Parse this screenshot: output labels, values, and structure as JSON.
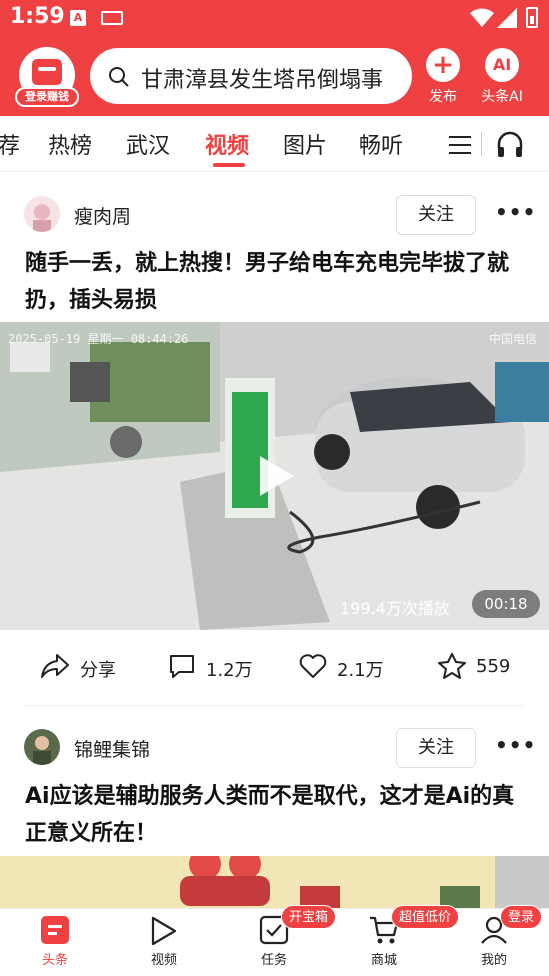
{
  "status_bar": {
    "time": "1:59"
  },
  "header": {
    "login_badge": "登录赚钱",
    "search_text": "甘肃漳县发生塔吊倒塌事",
    "publish_label": "发布",
    "ai_label": "头条AI",
    "ai_icon_text": "AI"
  },
  "tabs": [
    {
      "label": "荐"
    },
    {
      "label": "热榜"
    },
    {
      "label": "武汉"
    },
    {
      "label": "视频"
    },
    {
      "label": "图片"
    },
    {
      "label": "畅听"
    }
  ],
  "active_tab": "视频",
  "posts": [
    {
      "author": "瘦肉周",
      "follow_label": "关注",
      "title": "随手一丢，就上热搜！男子给电车充电完毕拔了就扔，插头易损",
      "video": {
        "timestamp_overlay": "2025-05-19 星期一 08:44:26",
        "operator_overlay": "中国电信",
        "views": "199.4万次播放",
        "duration": "00:18"
      },
      "actions": {
        "share": "分享",
        "comments": "1.2万",
        "likes": "2.1万",
        "favorites": "559"
      }
    },
    {
      "author": "锦鲤集锦",
      "follow_label": "关注",
      "title": "Ai应该是辅助服务人类而不是取代，这才是Ai的真正意义所在！"
    }
  ],
  "bottom_nav": [
    {
      "label": "头条",
      "badge": ""
    },
    {
      "label": "视频",
      "badge": ""
    },
    {
      "label": "任务",
      "badge": "开宝箱"
    },
    {
      "label": "商城",
      "badge": "超值低价"
    },
    {
      "label": "我的",
      "badge": "登录"
    }
  ],
  "colors": {
    "accent": "#f04142"
  }
}
